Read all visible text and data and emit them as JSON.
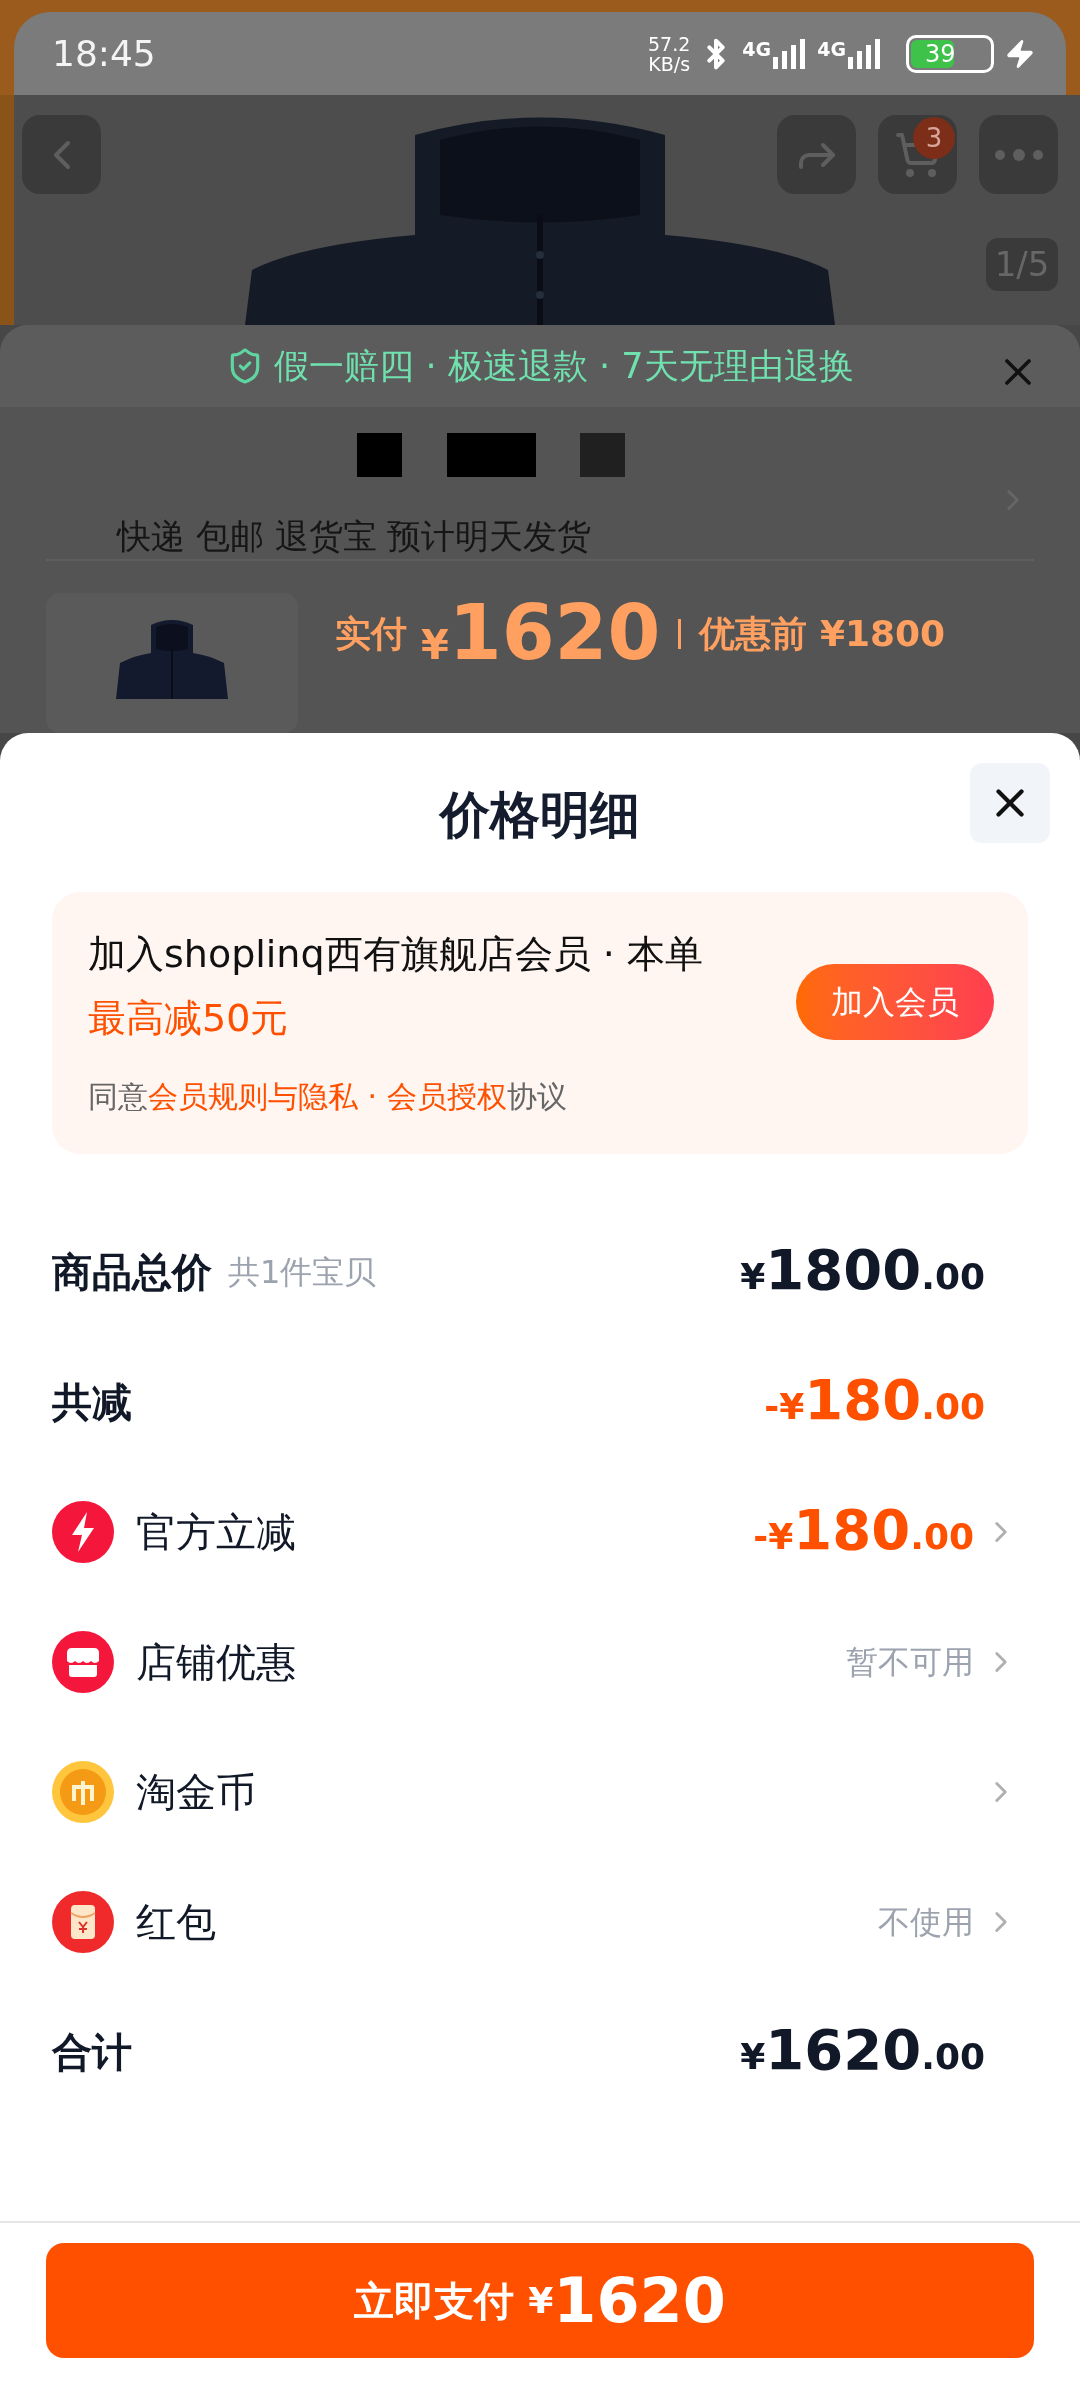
{
  "status_bar": {
    "time": "18:45",
    "speed_value": "57.2",
    "speed_unit": "KB/s",
    "network_1": "4G",
    "network_2": "4G",
    "battery": "39",
    "charging": true
  },
  "product_page": {
    "cart_count": "3",
    "image_counter": "1/5",
    "guarantee": "假一赔四 · 极速退款 · 7天无理由退换",
    "shipping": "快递 包邮 退货宝 预计明天发货",
    "paid_label": "实付",
    "paid_currency": "¥",
    "paid_amount": "1620",
    "original_price": "优惠前 ¥1800"
  },
  "price_sheet": {
    "title": "价格明细",
    "member_card": {
      "line_text": "加入shoplinq西有旗舰店会员 · 本单",
      "line_highlight": "最高减50元",
      "agree_prefix": "同意",
      "links": [
        "会员规则与隐私",
        "会员授权"
      ],
      "link_separator": " · ",
      "agree_suffix": "协议",
      "join_button": "加入会员"
    },
    "rows": [
      {
        "kind": "summary",
        "label": "商品总价",
        "note": "共1件宝贝",
        "amount": {
          "prefix": "¥",
          "integer": "1800",
          "decimal": ".00"
        },
        "highlight": false
      },
      {
        "kind": "summary",
        "label": "共减",
        "amount": {
          "prefix": "-¥",
          "integer": "180",
          "decimal": ".00"
        },
        "highlight": true
      },
      {
        "kind": "discount",
        "label": "官方立减",
        "amount": {
          "prefix": "-¥",
          "integer": "180",
          "decimal": ".00"
        },
        "highlight": true
      },
      {
        "kind": "discount",
        "label": "店铺优惠",
        "status": "暂不可用"
      },
      {
        "kind": "discount",
        "label": "淘金币"
      },
      {
        "kind": "discount",
        "label": "红包",
        "status": "不使用"
      },
      {
        "kind": "summary",
        "label": "合计",
        "amount": {
          "prefix": "¥",
          "integer": "1620",
          "decimal": ".00"
        },
        "highlight": false
      }
    ],
    "pay_button": {
      "label": "立即支付",
      "currency": "¥",
      "amount": "1620"
    }
  }
}
